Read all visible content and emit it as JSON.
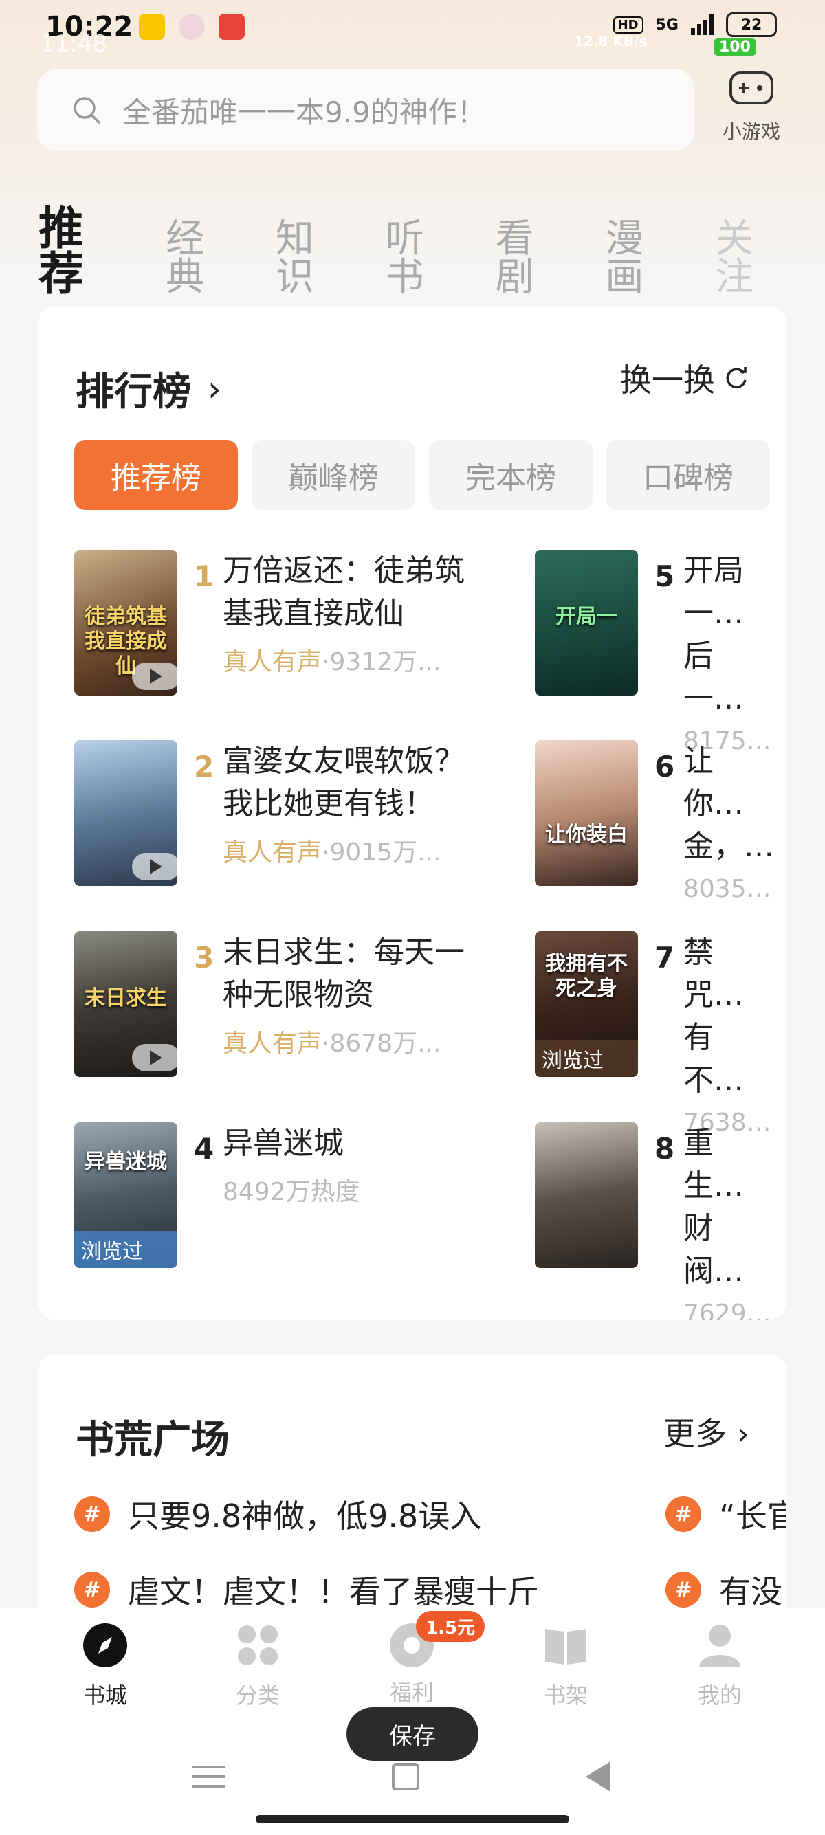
{
  "status": {
    "time": "10:22",
    "time_overlay": "11:48",
    "hd": "HD",
    "signal": "5G",
    "battery": "22",
    "net_speed": "12.8 KB/s",
    "battery_overlay": "100"
  },
  "search": {
    "placeholder": "全番茄唯一一本9.9的神作！"
  },
  "game": {
    "label": "小游戏"
  },
  "tabs": [
    {
      "label": "推荐"
    },
    {
      "label": "经典"
    },
    {
      "label": "知识"
    },
    {
      "label": "听书"
    },
    {
      "label": "看剧"
    },
    {
      "label": "漫画"
    },
    {
      "label": "关注"
    }
  ],
  "ranking": {
    "title": "排行榜",
    "swap": "换一换",
    "chips": [
      "推荐榜",
      "巅峰榜",
      "完本榜",
      "口碑榜"
    ],
    "items": [
      {
        "rank": "1",
        "title": "万倍返还：徒弟筑基我直接成仙",
        "voice": "真人有声",
        "heat": "·9312万...",
        "cover_text": "徒弟筑基我直接成仙"
      },
      {
        "rank": "2",
        "title": "富婆女友喂软饭？我比她更有钱！",
        "voice": "真人有声",
        "heat": "·9015万...",
        "cover_text": ""
      },
      {
        "rank": "3",
        "title": "末日求生：每天一种无限物资",
        "voice": "真人有声",
        "heat": "·8678万...",
        "cover_text": "末日求生"
      },
      {
        "rank": "4",
        "title": "异兽迷城",
        "voice": "",
        "heat": "8492万热度",
        "cover_text": "异兽迷城",
        "viewed": "浏览过"
      },
      {
        "rank": "5",
        "title": "开局一…后一…",
        "voice": "",
        "heat": "8175…",
        "cover_text": "开局一"
      },
      {
        "rank": "6",
        "title": "让你…金，…",
        "voice": "",
        "heat": "8035…",
        "cover_text": "让你装白"
      },
      {
        "rank": "7",
        "title": "禁咒…有不…",
        "voice": "",
        "heat": "7638…",
        "cover_text": "我拥有不死之身",
        "viewed": "浏览过"
      },
      {
        "rank": "8",
        "title": "重生…财阀…",
        "voice": "",
        "heat": "7629…",
        "cover_text": ""
      }
    ]
  },
  "square": {
    "title": "书荒广场",
    "more": "更多",
    "topics": [
      "只要9.8神做，低9.8误入",
      "“长官",
      "虐文！虐文！！看了暴瘦十斤",
      "有没"
    ]
  },
  "bottom_nav": [
    {
      "label": "书城"
    },
    {
      "label": "分类"
    },
    {
      "label": "福利",
      "badge": "1.5元"
    },
    {
      "label": "书架"
    },
    {
      "label": "我的"
    }
  ],
  "toast": "保存"
}
